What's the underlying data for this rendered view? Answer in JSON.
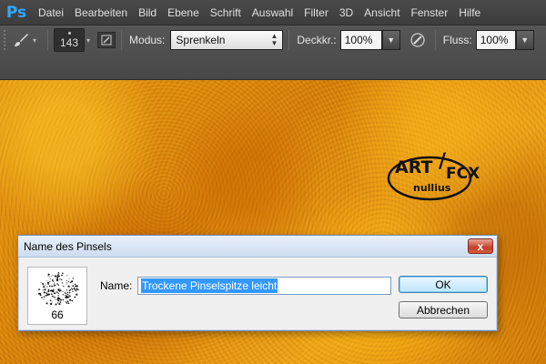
{
  "app": {
    "logo": "Ps",
    "menu": [
      "Datei",
      "Bearbeiten",
      "Bild",
      "Ebene",
      "Schrift",
      "Auswahl",
      "Filter",
      "3D",
      "Ansicht",
      "Fenster",
      "Hilfe"
    ]
  },
  "options": {
    "brush_size": "143",
    "mode_label": "Modus:",
    "mode_value": "Sprenkeln",
    "opacity_label": "Deckkr.:",
    "opacity_value": "100%",
    "flow_label": "Fluss:",
    "flow_value": "100%"
  },
  "canvas_logo": {
    "top_text": "ART",
    "slash": "/",
    "right_text": "FCX",
    "bottom_text": "nullius"
  },
  "dialog": {
    "title": "Name des Pinsels",
    "close": "x",
    "preview_size": "66",
    "name_label": "Name:",
    "name_value": "Trockene Pinselspitze leicht",
    "ok_label": "OK",
    "cancel_label": "Abbrechen"
  },
  "colors": {
    "accent": "#31a8ff",
    "selection": "#3399ff",
    "canvas": "#d88a10"
  },
  "icons": [
    "brush-icon",
    "brush-panel-icon",
    "airbrush-icon",
    "close-icon"
  ]
}
